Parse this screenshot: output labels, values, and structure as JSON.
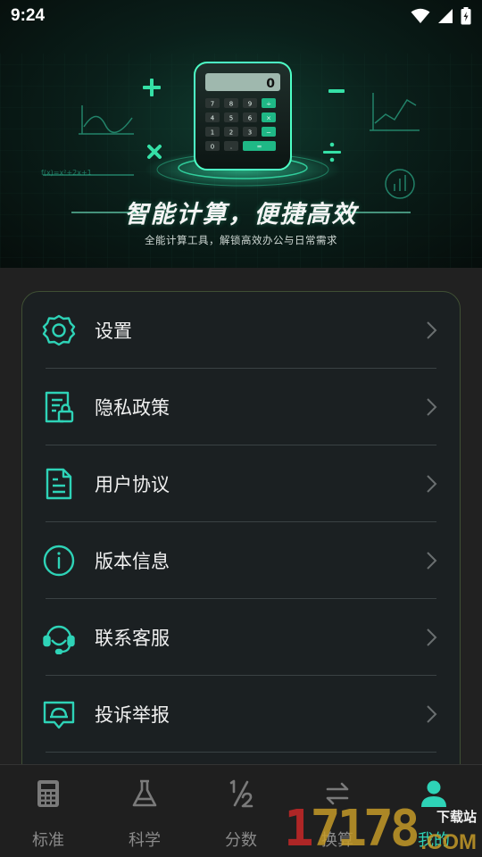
{
  "status_bar": {
    "time": "9:24"
  },
  "hero": {
    "title": "智能计算，便捷高效",
    "subtitle": "全能计算工具，解锁高效办公与日常需求",
    "calculator_display": "0",
    "calculator_keys": [
      "7",
      "8",
      "9",
      "÷",
      "4",
      "5",
      "6",
      "×",
      "1",
      "2",
      "3",
      "−",
      "0",
      ".",
      "="
    ],
    "accent_color": "#2ed3b7"
  },
  "menu": {
    "items": [
      {
        "label": "设置",
        "icon": "gear-icon"
      },
      {
        "label": "隐私政策",
        "icon": "privacy-doc-lock-icon"
      },
      {
        "label": "用户协议",
        "icon": "document-icon"
      },
      {
        "label": "版本信息",
        "icon": "info-icon"
      },
      {
        "label": "联系客服",
        "icon": "headset-icon"
      },
      {
        "label": "投诉举报",
        "icon": "report-icon"
      }
    ]
  },
  "tabs": [
    {
      "label": "标准",
      "icon": "calculator-icon",
      "active": false
    },
    {
      "label": "科学",
      "icon": "flask-icon",
      "active": false
    },
    {
      "label": "分数",
      "icon": "fraction-icon",
      "active": false
    },
    {
      "label": "换算",
      "icon": "swap-arrows-icon",
      "active": false
    },
    {
      "label": "我的",
      "icon": "person-icon",
      "active": true
    }
  ],
  "watermark": {
    "number": "17178",
    "site_text": "下载站",
    "domain": ".COM"
  },
  "colors": {
    "accent": "#2ed3b7",
    "background": "#212121",
    "card": "#1b2022",
    "card_border": "#3f4f34"
  }
}
